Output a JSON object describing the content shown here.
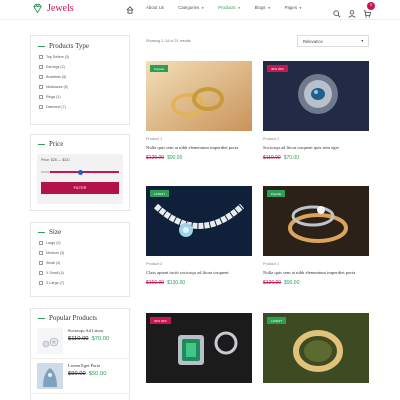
{
  "brand": {
    "name": "Jewels",
    "color": "#c8174f"
  },
  "nav": [
    {
      "label": "About Us",
      "caret": false,
      "active": false
    },
    {
      "label": "Categories",
      "caret": true,
      "active": false
    },
    {
      "label": "Products",
      "caret": true,
      "active": true
    },
    {
      "label": "Blogs",
      "caret": true,
      "active": false
    },
    {
      "label": "Pages",
      "caret": true,
      "active": false
    }
  ],
  "cart_count": "0",
  "sidebar": {
    "product_type": {
      "title": "Products Type",
      "items": [
        "Top Sellers (3)",
        "Earrings (2)",
        "Bracelets (5)",
        "Necklaces (5)",
        "Rings (1)",
        "Diamond (7)"
      ]
    },
    "price": {
      "title": "Price",
      "range_label": "Price: $28 — $321",
      "button": "FILTER"
    },
    "size": {
      "title": "Size",
      "items": [
        "Large (3)",
        "Medium (3)",
        "Small (4)",
        "X Small (4)",
        "X Large (7)"
      ]
    },
    "popular": {
      "title": "Popular Products",
      "items": [
        {
          "name": "Sociosqu Ad Litora",
          "old": "$110.00",
          "new": "$70.00"
        },
        {
          "name": "Lorem Eget Porta",
          "old": "$90.00",
          "new": "$50.00"
        }
      ]
    }
  },
  "main": {
    "showing": "Showing 1–18 of 21 results",
    "sort": "Relevance"
  },
  "products": [
    {
      "badge": "Popular",
      "badge_color": "green",
      "category": "Product 1",
      "title": "Nulla quis sem at nibh elementum imperdiet porta",
      "old": "$120.00",
      "new": "$90.00"
    },
    {
      "badge": "40% OFF",
      "badge_color": "red",
      "category": "Product 2",
      "title": "Sociosqu ad litora torquent quis sem eget",
      "old": "$110.00",
      "new": "$70.00"
    },
    {
      "badge": "LATEST",
      "badge_color": "green",
      "category": "Product 3",
      "title": "Class aptent taciti sociosqu ad litora torquent",
      "old": "$160.00",
      "new": "$130.00"
    },
    {
      "badge": "Popular",
      "badge_color": "green",
      "category": "Product 1",
      "title": "Nulla quis sem at nibh elementum imperdiet porta",
      "old": "$120.00",
      "new": "$90.00"
    },
    {
      "badge": "40% OFF",
      "badge_color": "red",
      "category": "",
      "title": "",
      "old": "",
      "new": ""
    },
    {
      "badge": "LATEST",
      "badge_color": "green",
      "category": "",
      "title": "",
      "old": "",
      "new": ""
    }
  ]
}
